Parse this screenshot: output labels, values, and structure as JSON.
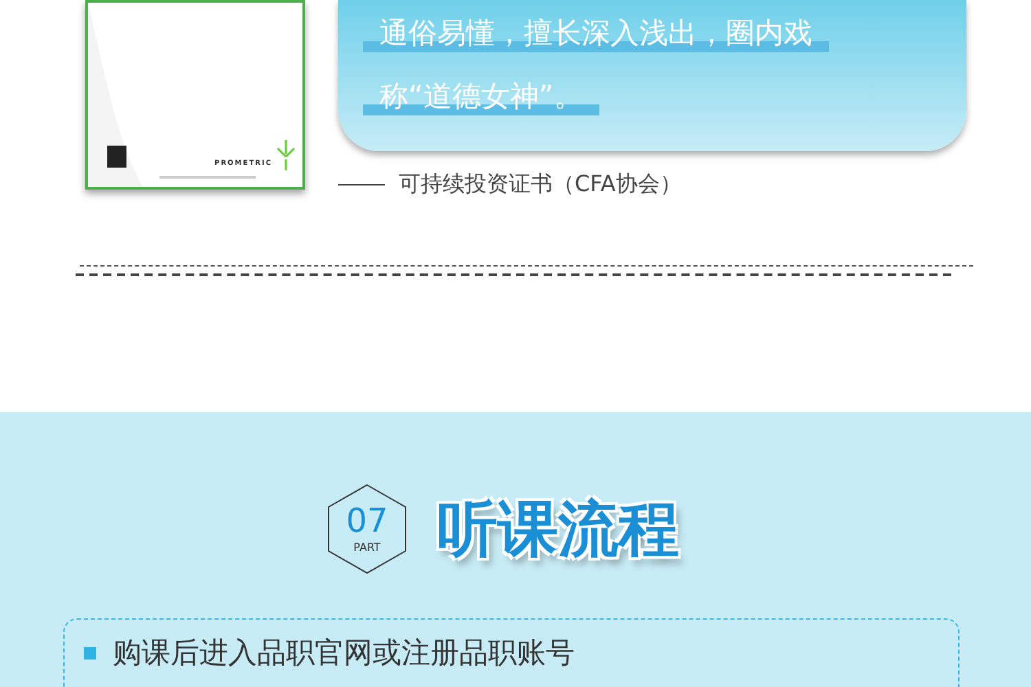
{
  "certificate": {
    "brand": "PROMETRIC"
  },
  "quote": {
    "lines": [
      "通俗易懂，擅长深入浅出，圈内戏",
      "称“道德女神”。"
    ],
    "source": "可持续投资证书（CFA协会）"
  },
  "section": {
    "number": "07",
    "part": "PART",
    "title": "听课流程"
  },
  "steps": [
    "购课后进入品职官网或注册品职账号"
  ]
}
